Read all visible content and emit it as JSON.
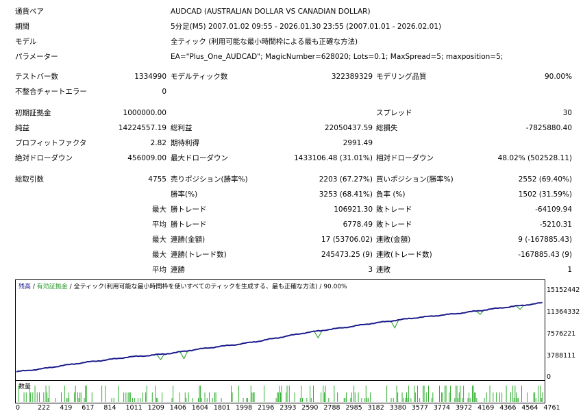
{
  "header": [
    {
      "label": "通貨ペア",
      "value": "AUDCAD (AUSTRALIAN DOLLAR VS CANADIAN DOLLAR)"
    },
    {
      "label": "期間",
      "value": "5分足(M5) 2007.01.02 09:55 - 2026.01.30 23:55 (2007.01.01 - 2026.02.01)"
    },
    {
      "label": "モデル",
      "value": "全ティック (利用可能な最小時間枠による最も正確な方法)"
    },
    {
      "label": "パラメーター",
      "value": "EA=\"Plus_One_AUDCAD\"; MagicNumber=628020; Lots=0.1; MaxSpread=5; maxposition=5;"
    }
  ],
  "stats": {
    "test_bars_label": "テストバー数",
    "test_bars": "1334990",
    "model_ticks_label": "モデルティック数",
    "model_ticks": "322389329",
    "modeling_quality_label": "モデリング品質",
    "modeling_quality": "90.00%",
    "mismatch_label": "不整合チャートエラー",
    "mismatch": "0",
    "initial_deposit_label": "初期証拠金",
    "initial_deposit": "1000000.00",
    "spread_label": "スプレッド",
    "spread": "30",
    "net_profit_label": "純益",
    "net_profit": "14224557.19",
    "gross_profit_label": "総利益",
    "gross_profit": "22050437.59",
    "gross_loss_label": "総損失",
    "gross_loss": "-7825880.40",
    "profit_factor_label": "プロフィットファクタ",
    "profit_factor": "2.82",
    "expected_payoff_label": "期待利得",
    "expected_payoff": "2991.49",
    "abs_dd_label": "絶対ドローダウン",
    "abs_dd": "456009.00",
    "max_dd_label": "最大ドローダウン",
    "max_dd": "1433106.48 (31.01%)",
    "rel_dd_label": "相対ドローダウン",
    "rel_dd": "48.02% (502528.11)",
    "total_trades_label": "総取引数",
    "total_trades": "4755",
    "short_label": "売りポジション(勝率%)",
    "short": "2203 (67.27%)",
    "long_label": "買いポジション(勝率%)",
    "long": "2552 (69.40%)",
    "win_pct_label": "勝率(%)",
    "win_pct": "3253 (68.41%)",
    "loss_pct_label": "負率 (%)",
    "loss_pct": "1502 (31.59%)",
    "max_label": "最大",
    "avg_label": "平均",
    "win_trade_label": "勝トレード",
    "loss_trade_label": "敗トレード",
    "max_win_trade": "106921.30",
    "max_loss_trade": "-64109.94",
    "avg_win_trade": "6778.49",
    "avg_loss_trade": "-5210.31",
    "consec_win_amt_label": "連勝(金額)",
    "consec_win_amt": "17 (53706.02)",
    "consec_loss_amt_label": "連敗(金額)",
    "consec_loss_amt": "9 (-167885.43)",
    "consec_win_cnt_label": "連勝(トレード数)",
    "consec_win_cnt": "245473.25 (9)",
    "consec_loss_cnt_label": "連敗(トレード数)",
    "consec_loss_cnt": "-167885.43 (9)",
    "avg_consec_win_label": "連勝",
    "avg_consec_win": "3",
    "avg_consec_loss_label": "連敗",
    "avg_consec_loss": "1"
  },
  "chart_data": {
    "type": "line",
    "legend": {
      "balance": "残高",
      "sep1": " / ",
      "equity": "有効証拠金",
      "sep2": " / ",
      "model": "全ティック(利用可能な最小時間枠を使いすべてのティックを生成する、最も正確な方法)",
      "sep3": " / ",
      "quality": "90.00%"
    },
    "volume_label": "数量",
    "y_ticks": [
      "15152442",
      "11364332",
      "7576221",
      "3788111",
      "0"
    ],
    "x_ticks": [
      "0",
      "222",
      "419",
      "617",
      "814",
      "1011",
      "1209",
      "1406",
      "1604",
      "1801",
      "1998",
      "2196",
      "2393",
      "2590",
      "2788",
      "2985",
      "3182",
      "3380",
      "3577",
      "3774",
      "3972",
      "4169",
      "4366",
      "4564",
      "4761"
    ],
    "x_range": [
      0,
      4755
    ],
    "y_range": [
      0,
      16000000
    ],
    "balance_points": [
      [
        0,
        1000000
      ],
      [
        222,
        1500000
      ],
      [
        419,
        2100000
      ],
      [
        617,
        2650000
      ],
      [
        814,
        3100000
      ],
      [
        1011,
        3600000
      ],
      [
        1209,
        3900000
      ],
      [
        1406,
        4300000
      ],
      [
        1604,
        4900000
      ],
      [
        1801,
        5400000
      ],
      [
        1998,
        5850000
      ],
      [
        2196,
        6450000
      ],
      [
        2393,
        7150000
      ],
      [
        2590,
        7850000
      ],
      [
        2788,
        8400000
      ],
      [
        2985,
        8900000
      ],
      [
        3182,
        9500000
      ],
      [
        3380,
        10000000
      ],
      [
        3577,
        10500000
      ],
      [
        3774,
        10900000
      ],
      [
        3972,
        11300000
      ],
      [
        4169,
        11800000
      ],
      [
        4366,
        12300000
      ],
      [
        4564,
        12750000
      ],
      [
        4761,
        13250000
      ]
    ],
    "equity_dips": [
      [
        1300,
        3150000
      ],
      [
        1510,
        3300000
      ],
      [
        2720,
        7000000
      ],
      [
        3410,
        8750000
      ],
      [
        4180,
        11150000
      ],
      [
        4540,
        12050000
      ]
    ],
    "colors": {
      "balance": "#1a1a8c",
      "equity": "#1a9a1a",
      "volume": "#1aa61a",
      "legend_balance": "#1a1a8c",
      "legend_equity": "#2e9a2e"
    }
  }
}
